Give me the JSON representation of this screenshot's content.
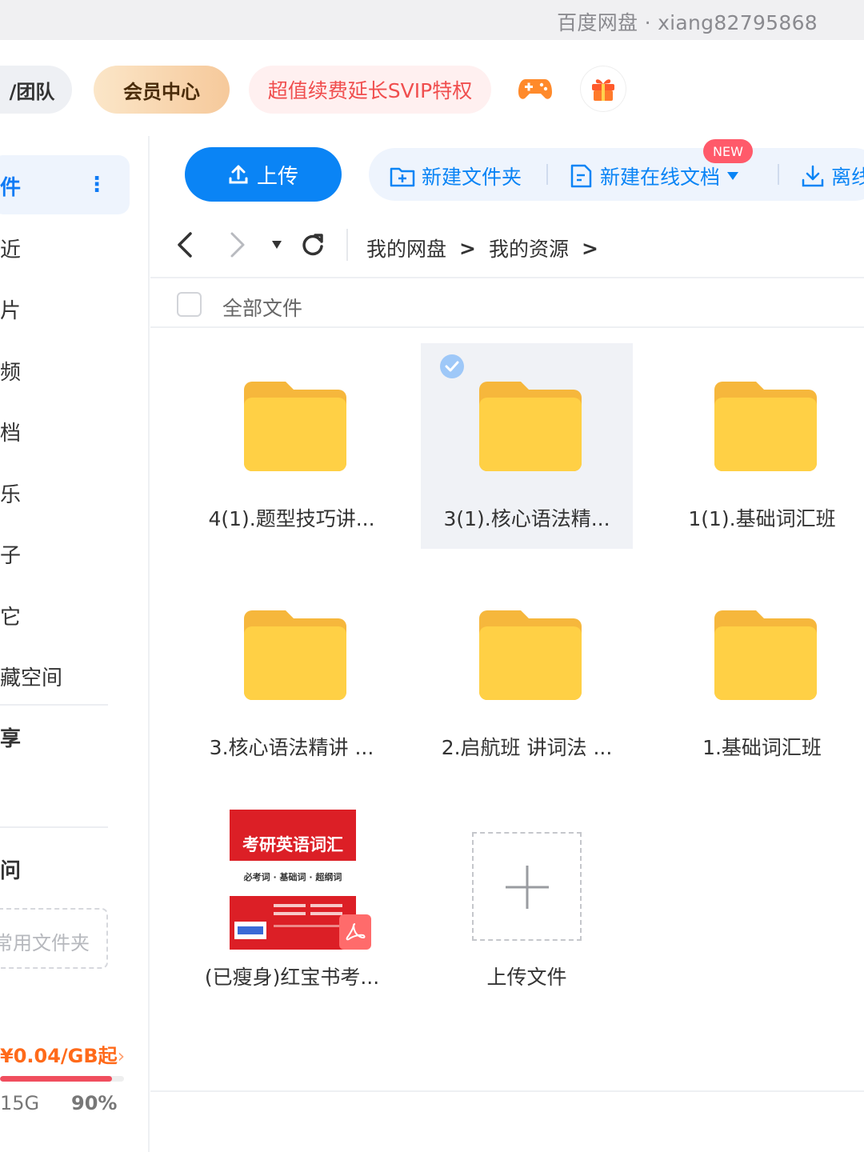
{
  "titlebar": {
    "account": "百度网盘 · xiang82795868"
  },
  "top": {
    "team_label": "/团队",
    "vip_label": "会员中心",
    "promo_label": "超值续费延长SVIP特权",
    "game_icon": "gamepad-icon",
    "gift_icon": "gift-icon"
  },
  "sidebar": {
    "active": {
      "label": "件",
      "more": "⋮"
    },
    "items": [
      {
        "label": "近"
      },
      {
        "label": "片"
      },
      {
        "label": "频"
      },
      {
        "label": "档"
      },
      {
        "label": "乐"
      },
      {
        "label": "子"
      },
      {
        "label": "它"
      },
      {
        "label": "藏空间"
      }
    ],
    "share_label": "享",
    "section_label": "问",
    "common_folder_placeholder": "常用文件夹",
    "price": "¥0.04/GB起",
    "price_arrow": "›",
    "storage_total": "15G",
    "storage_pct": "90%",
    "storage_fraction": 0.9,
    "accent": "#0f7bf5",
    "price_color": "#ff6a1a",
    "bar_color": "#f04e5e"
  },
  "toolbar": {
    "upload": "上传",
    "new_folder": "新建文件夹",
    "new_doc": "新建在线文档",
    "new_badge": "NEW",
    "offline": "离线",
    "accent": "#0a84f5"
  },
  "nav": {
    "back_icon": "back-arrow-icon",
    "forward_icon": "forward-arrow-icon",
    "dropdown_icon": "dropdown-caret-icon",
    "refresh_icon": "refresh-icon",
    "crumbs": [
      "我的网盘",
      "我的资源"
    ],
    "separator": ">"
  },
  "list": {
    "all_files": "全部文件"
  },
  "files": [
    {
      "name": "4(1).题型技巧讲...",
      "selected": false
    },
    {
      "name": "3(1).核心语法精...",
      "selected": true
    },
    {
      "name": "1(1).基础词汇班",
      "selected": false
    },
    {
      "name": "3.核心语法精讲 ...",
      "selected": false
    },
    {
      "name": "2.启航班 讲词法 ...",
      "selected": false
    },
    {
      "name": "1.基础词汇班",
      "selected": false
    }
  ],
  "pdf_file": {
    "name": "(已瘦身)红宝书考...",
    "cover_title": "考研英语词汇",
    "cover_sub": "必考词 · 基础词 · 超纲词"
  },
  "upload_tile": {
    "label": "上传文件"
  }
}
